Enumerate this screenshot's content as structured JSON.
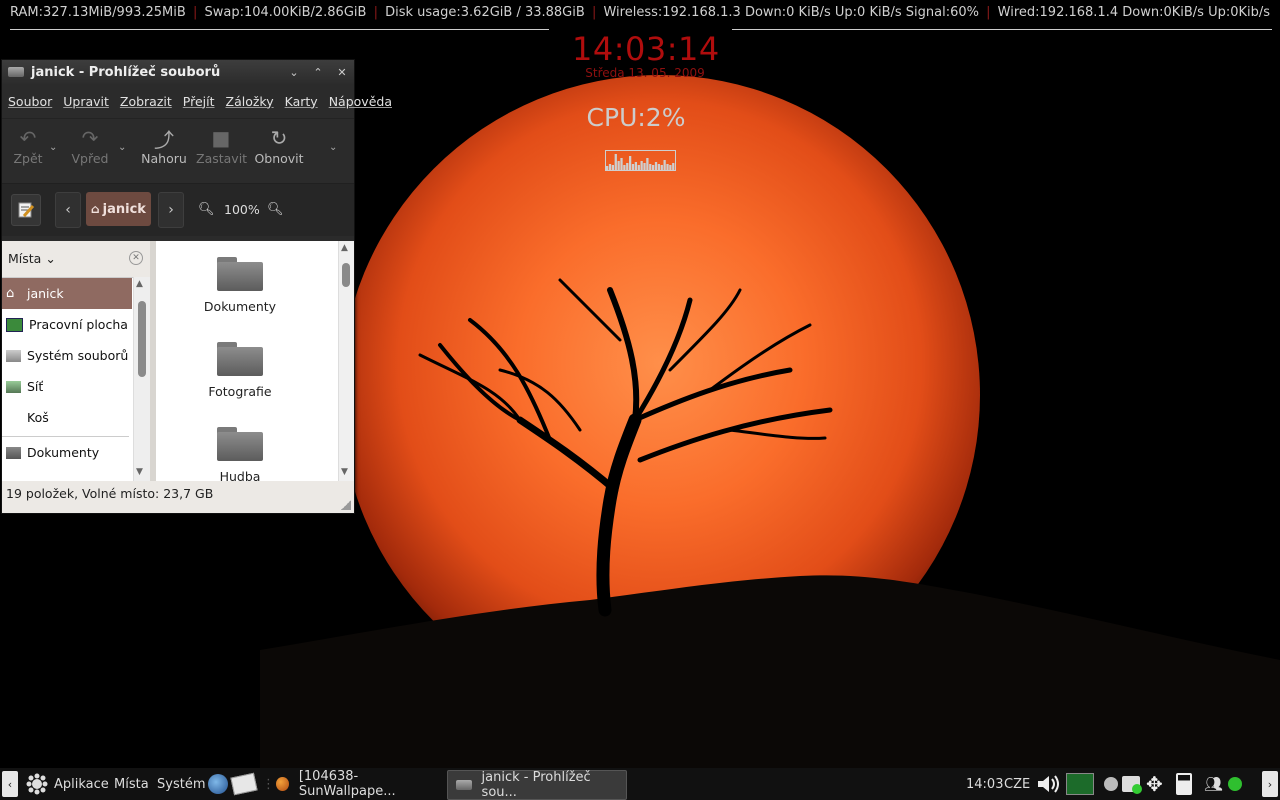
{
  "conky": {
    "ram": "RAM:327.13MiB/993.25MiB",
    "swap": "Swap:104.00KiB/2.86GiB",
    "disk": "Disk usage:3.62GiB / 33.88GiB",
    "wireless": "Wireless:192.168.1.3 Down:0 KiB/s Up:0 KiB/s Signal:60%",
    "wired": "Wired:192.168.1.4 Down:0KiB/s Up:0Kib/s",
    "separator": "|",
    "clock": "14:03:14",
    "date": "Středa 13. 05. 2009",
    "cpu": "CPU:2%",
    "cpu_graph": [
      4,
      6,
      5,
      16,
      9,
      12,
      5,
      7,
      14,
      6,
      8,
      5,
      9,
      7,
      12,
      6,
      5,
      8,
      6,
      5,
      10,
      6,
      5,
      7
    ],
    "accent_color": "#b00d0d"
  },
  "window": {
    "title": "janick - Prohlížeč souborů",
    "title_icon": "folder-icon",
    "buttons": {
      "minimize": "⌄",
      "maximize": "⌃",
      "close": "✕"
    },
    "menu": [
      "Soubor",
      "Upravit",
      "Zobrazit",
      "Přejít",
      "Záložky",
      "Karty",
      "Nápověda"
    ],
    "toolbar": {
      "back": "Zpět",
      "forward": "Vpřed",
      "up": "Nahoru",
      "stop": "Zastavit",
      "reload": "Obnovit",
      "more": "⌄"
    },
    "location": {
      "crumb": "janick",
      "zoom": "100%"
    },
    "sidebar": {
      "header": "Místa",
      "items": [
        {
          "label": "janick",
          "icon": "home-icon",
          "selected": true
        },
        {
          "label": "Pracovní plocha",
          "icon": "desktop-icon",
          "selected": false
        },
        {
          "label": "Systém souborů",
          "icon": "drive-icon",
          "selected": false
        },
        {
          "label": "Síť",
          "icon": "network-icon",
          "selected": false
        },
        {
          "label": "Koš",
          "icon": "trash-icon",
          "selected": false
        },
        {
          "label": "Dokumenty",
          "icon": "folder-icon",
          "selected": false
        }
      ]
    },
    "files": [
      "Dokumenty",
      "Fotografie",
      "Hudba"
    ],
    "status": "19 položek, Volné místo: 23,7 GB"
  },
  "panel": {
    "prev": "‹",
    "next": "›",
    "menus": [
      "Aplikace",
      "Místa",
      "Systém"
    ],
    "tasks": [
      {
        "label": "[104638-SunWallpape...",
        "icon": "firefox-icon",
        "active": false
      },
      {
        "label": "janick - Prohlížeč sou...",
        "icon": "folder-icon",
        "active": true
      }
    ],
    "time": "14:03",
    "keyboard": "CZE"
  }
}
